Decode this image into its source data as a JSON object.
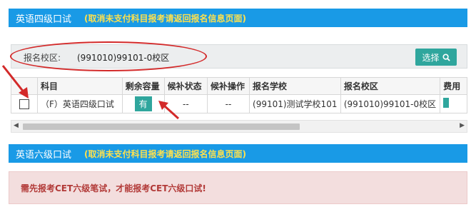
{
  "cet4": {
    "title": "英语四级口试",
    "hint": "(取消未支付科目报考请返回报名信息页面)"
  },
  "campus": {
    "label": "报名校区:",
    "value": "(991010)99101-0校区",
    "choose_label": "选择"
  },
  "table": {
    "columns": [
      "科目",
      "剩余容量",
      "候补状态",
      "候补操作",
      "报名学校",
      "报名校区",
      "费用"
    ],
    "rows": [
      {
        "subject": "（F）英语四级口试",
        "capacity": "有",
        "waitlist_status": "--",
        "waitlist_action": "--",
        "school": "(99101)测试学校101",
        "campus": "(991010)99101-0校区"
      }
    ]
  },
  "cet6": {
    "title": "英语六级口试",
    "hint": "(取消未支付科目报考请返回报名信息页面)"
  },
  "warning": {
    "text": "需先报考CET六级笔试，才能报考CET六级口试!"
  },
  "colors": {
    "header_bg": "#199ae6",
    "hint_text": "#ffe14d",
    "accent": "#2fa69d",
    "annotation": "#d32a2a",
    "warning_bg": "#f3dede"
  }
}
